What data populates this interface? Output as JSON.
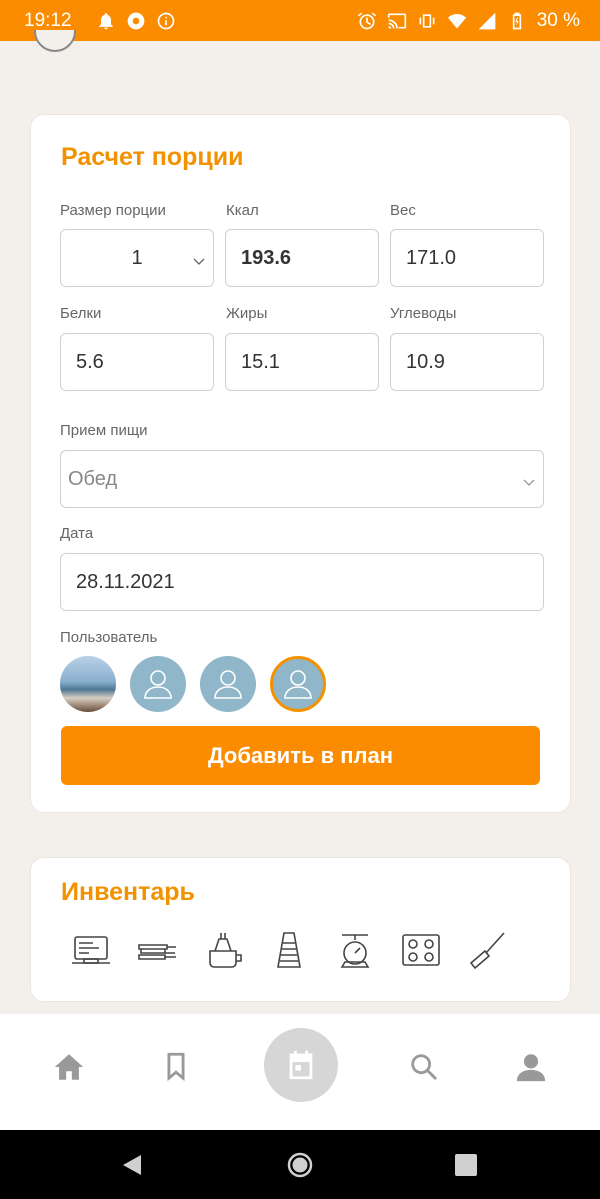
{
  "status_bar": {
    "time": "19:12",
    "battery": "30 %"
  },
  "portion_card": {
    "title": "Расчет порции",
    "fields": {
      "portion_size": {
        "label": "Размер порции",
        "value": "1"
      },
      "kcal": {
        "label": "Ккал",
        "value": "193.6"
      },
      "weight": {
        "label": "Вес",
        "value": "171.0"
      },
      "protein": {
        "label": "Белки",
        "value": "5.6"
      },
      "fat": {
        "label": "Жиры",
        "value": "15.1"
      },
      "carbs": {
        "label": "Углеводы",
        "value": "10.9"
      }
    },
    "meal": {
      "label": "Прием пищи",
      "placeholder": "Обед"
    },
    "date": {
      "label": "Дата",
      "value": "28.11.2021"
    },
    "users": {
      "label": "Пользователь"
    },
    "add_button": "Добавить в план"
  },
  "inventory_card": {
    "title": "Инвентарь",
    "tools": [
      "laptop-icon",
      "pans-icon",
      "juicer-icon",
      "grater-icon",
      "scale-icon",
      "stove-icon",
      "spatula-icon"
    ]
  },
  "colors": {
    "accent": "#fb8c00",
    "title": "#f39200",
    "avatar": "#8fb6c9"
  }
}
